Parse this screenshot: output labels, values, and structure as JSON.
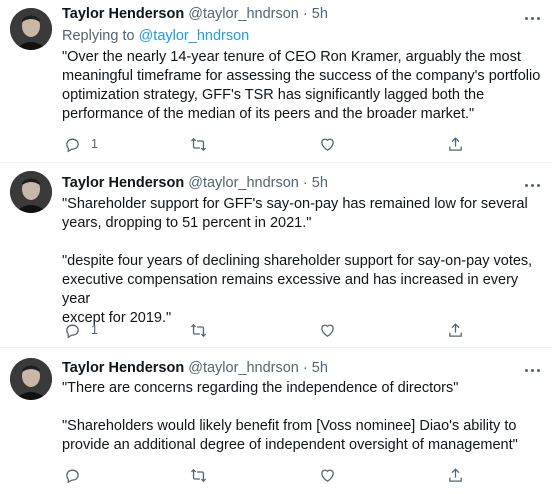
{
  "tweets": [
    {
      "name": "Taylor Henderson",
      "handle": "@taylor_hndrson",
      "separator": "·",
      "time": "5h",
      "reply_prefix": "Replying to",
      "reply_handle": "@taylor_hndrson",
      "paragraphs": [
        "\"Over the nearly 14-year tenure of CEO Ron Kramer, arguably the most\nmeaningful timeframe for assessing the success of the company's portfolio\noptimization strategy, GFF's TSR has significantly lagged both the\nperformance of the median of its peers and the broader market.\""
      ],
      "reply_count": "1",
      "icons": [
        "reply-icon",
        "retweet-icon",
        "like-icon",
        "share-icon"
      ]
    },
    {
      "name": "Taylor Henderson",
      "handle": "@taylor_hndrson",
      "separator": "·",
      "time": "5h",
      "paragraphs": [
        "\"Shareholder support for GFF's say-on-pay has remained low for several\nyears, dropping to 51 percent in 2021.\"",
        "\"despite four years of declining shareholder support for say-on-pay votes,\nexecutive compensation remains excessive and has increased in every year\nexcept for 2019.\""
      ],
      "reply_count": "1",
      "icons": [
        "reply-icon",
        "retweet-icon",
        "like-icon",
        "share-icon"
      ]
    },
    {
      "name": "Taylor Henderson",
      "handle": "@taylor_hndrson",
      "separator": "·",
      "time": "5h",
      "paragraphs": [
        "\"There are concerns regarding the independence of directors\"",
        "\"Shareholders would likely benefit from [Voss nominee] Diao's ability to\nprovide an additional degree of independent oversight of management\""
      ],
      "reply_count": "",
      "icons": [
        "reply-icon",
        "retweet-icon",
        "like-icon",
        "share-icon"
      ]
    }
  ],
  "colors": {
    "text": "#0f1419",
    "secondary": "#536471",
    "link": "#1d9bf0",
    "divider": "#eff3f4"
  }
}
